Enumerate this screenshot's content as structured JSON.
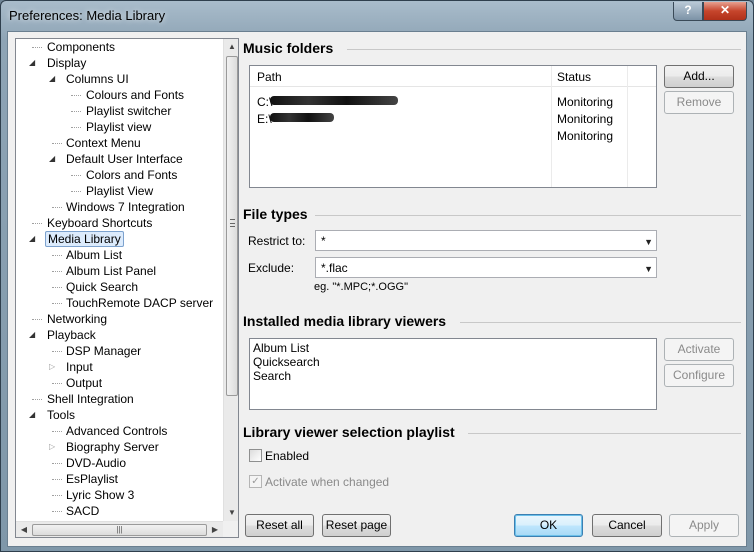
{
  "window": {
    "title": "Preferences: Media Library",
    "help_label": "?",
    "close_label": "✕"
  },
  "tree": [
    {
      "label": "Components",
      "level": 0,
      "expander": "none"
    },
    {
      "label": "Display",
      "level": 0,
      "expander": "expanded"
    },
    {
      "label": "Columns UI",
      "level": 1,
      "expander": "expanded"
    },
    {
      "label": "Colours and Fonts",
      "level": 2,
      "expander": "none"
    },
    {
      "label": "Playlist switcher",
      "level": 2,
      "expander": "none"
    },
    {
      "label": "Playlist view",
      "level": 2,
      "expander": "none"
    },
    {
      "label": "Context Menu",
      "level": 1,
      "expander": "none"
    },
    {
      "label": "Default User Interface",
      "level": 1,
      "expander": "expanded"
    },
    {
      "label": "Colors and Fonts",
      "level": 2,
      "expander": "none"
    },
    {
      "label": "Playlist View",
      "level": 2,
      "expander": "none"
    },
    {
      "label": "Windows 7 Integration",
      "level": 1,
      "expander": "none"
    },
    {
      "label": "Keyboard Shortcuts",
      "level": 0,
      "expander": "none"
    },
    {
      "label": "Media Library",
      "level": 0,
      "expander": "expanded",
      "selected": true
    },
    {
      "label": "Album List",
      "level": 1,
      "expander": "none"
    },
    {
      "label": "Album List Panel",
      "level": 1,
      "expander": "none"
    },
    {
      "label": "Quick Search",
      "level": 1,
      "expander": "none"
    },
    {
      "label": "TouchRemote DACP server",
      "level": 1,
      "expander": "none"
    },
    {
      "label": "Networking",
      "level": 0,
      "expander": "none"
    },
    {
      "label": "Playback",
      "level": 0,
      "expander": "expanded"
    },
    {
      "label": "DSP Manager",
      "level": 1,
      "expander": "none"
    },
    {
      "label": "Input",
      "level": 1,
      "expander": "collapsed"
    },
    {
      "label": "Output",
      "level": 1,
      "expander": "none"
    },
    {
      "label": "Shell Integration",
      "level": 0,
      "expander": "none"
    },
    {
      "label": "Tools",
      "level": 0,
      "expander": "expanded"
    },
    {
      "label": "Advanced Controls",
      "level": 1,
      "expander": "none"
    },
    {
      "label": "Biography Server",
      "level": 1,
      "expander": "collapsed"
    },
    {
      "label": "DVD-Audio",
      "level": 1,
      "expander": "none"
    },
    {
      "label": "EsPlaylist",
      "level": 1,
      "expander": "none"
    },
    {
      "label": "Lyric Show 3",
      "level": 1,
      "expander": "none"
    },
    {
      "label": "SACD",
      "level": 1,
      "expander": "none"
    }
  ],
  "music_folders": {
    "heading": "Music folders",
    "col_path": "Path",
    "col_status": "Status",
    "rows": [
      {
        "path": "C:\\",
        "status": "Monitoring"
      },
      {
        "path": "E:\\",
        "status": "Monitoring"
      },
      {
        "path": "",
        "status": "Monitoring"
      }
    ],
    "add_label": "Add...",
    "remove_label": "Remove"
  },
  "file_types": {
    "heading": "File types",
    "restrict_label": "Restrict to:",
    "restrict_value": "*",
    "exclude_label": "Exclude:",
    "exclude_value": "*.flac",
    "hint": "eg. \"*.MPC;*.OGG\""
  },
  "viewers": {
    "heading": "Installed media library viewers",
    "items": [
      "Album List",
      "Quicksearch",
      "Search"
    ],
    "activate_label": "Activate",
    "configure_label": "Configure"
  },
  "selection_playlist": {
    "heading": "Library viewer selection playlist",
    "enabled_label": "Enabled",
    "enabled_checked": false,
    "activate_label": "Activate when changed",
    "activate_checked": true
  },
  "footer": {
    "reset_all": "Reset all",
    "reset_page": "Reset page",
    "ok": "OK",
    "cancel": "Cancel",
    "apply": "Apply"
  }
}
